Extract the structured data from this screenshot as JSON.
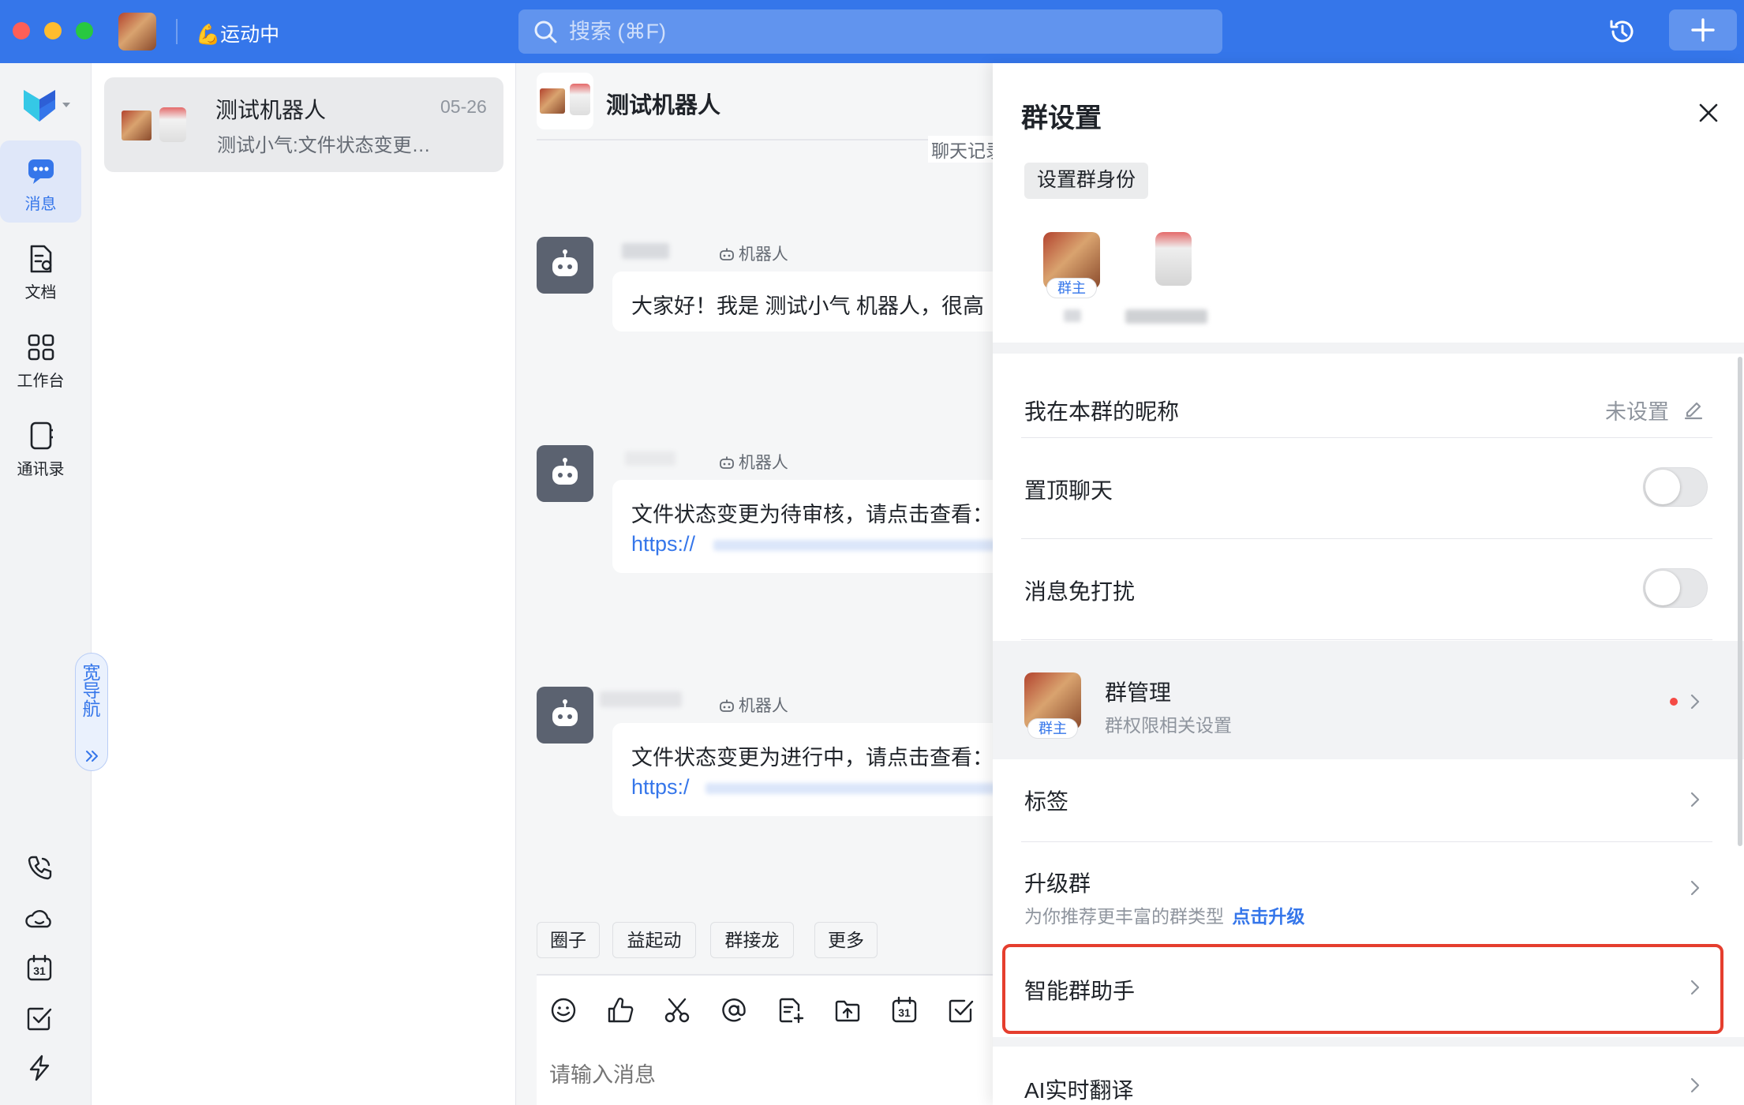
{
  "titlebar": {
    "status": "💪运动中",
    "search_placeholder": "搜索 (⌘F)",
    "colors": {
      "bar": "#3576ea",
      "close": "#fe5f57",
      "minimize": "#febc2e",
      "zoom": "#28c840"
    }
  },
  "nav": {
    "items": [
      {
        "label": "消息",
        "icon": "message-icon",
        "active": true
      },
      {
        "label": "文档",
        "icon": "document-icon",
        "active": false
      },
      {
        "label": "工作台",
        "icon": "workbench-icon",
        "active": false
      },
      {
        "label": "通讯录",
        "icon": "contacts-icon",
        "active": false
      }
    ],
    "wide_nav": "宽导航",
    "bottom_icons": [
      "phone-icon",
      "cloud-icon",
      "calendar-icon",
      "task-icon",
      "lightning-icon"
    ],
    "calendar_day": "31"
  },
  "conversation": {
    "name": "测试机器人",
    "date": "05-26",
    "preview": "测试小气:文件状态变更…"
  },
  "chat": {
    "title": "测试机器人",
    "history_hint": "聊天记录",
    "bot_badge": "机器人",
    "messages": [
      {
        "text": "大家好！我是 测试小气 机器人，很高"
      },
      {
        "text": "文件状态变更为待审核，请点击查看：",
        "link": "https://"
      },
      {
        "text": "文件状态变更为进行中，请点击查看：",
        "link": "https:/"
      }
    ],
    "quick_actions": [
      "圈子",
      "益起动",
      "群接龙",
      "更多"
    ],
    "input_placeholder": "请输入消息",
    "toolbar_icons": [
      "emoji-icon",
      "thumbs-up-icon",
      "scissors-icon",
      "mention-icon",
      "doc-add-icon",
      "folder-upload-icon",
      "calendar-icon",
      "checkbox-icon"
    ]
  },
  "panel": {
    "title": "群设置",
    "set_identity": "设置群身份",
    "owner_badge": "群主",
    "nickname_label": "我在本群的昵称",
    "nickname_value": "未设置",
    "pin_label": "置顶聊天",
    "pin_on": false,
    "mute_label": "消息免打扰",
    "mute_on": false,
    "manage_title": "群管理",
    "manage_sub": "群权限相关设置",
    "manage_dot_color": "#f54a45",
    "tags_label": "标签",
    "upgrade_title": "升级群",
    "upgrade_sub": "为你推荐更丰富的群类型",
    "upgrade_link": "点击升级",
    "assistant_label": "智能群助手",
    "translate_label": "AI实时翻译",
    "highlight_color": "#e53e2e",
    "link_color": "#3576ea"
  }
}
